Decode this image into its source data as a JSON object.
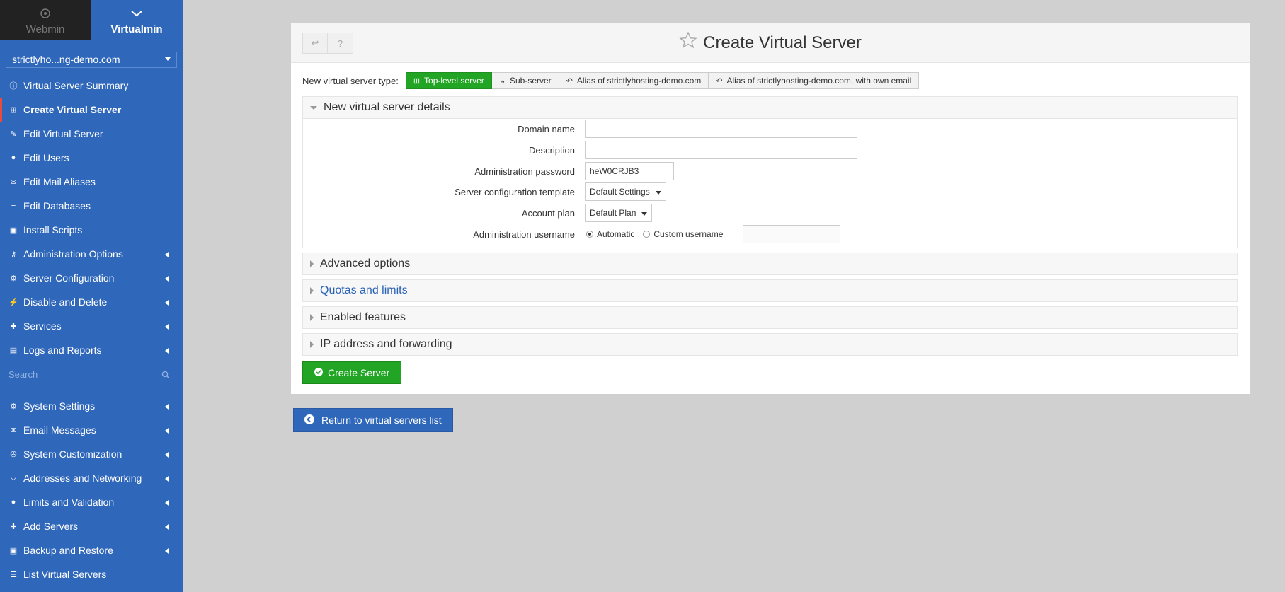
{
  "switcher": {
    "webmin_label": "Webmin",
    "virtualmin_label": "Virtualmin"
  },
  "domain_select": {
    "value": "strictlyho...ng-demo.com"
  },
  "sidebar": {
    "items": [
      {
        "label": "Virtual Server Summary",
        "icon": "info-circle-icon"
      },
      {
        "label": "Create Virtual Server",
        "icon": "plus-square-icon"
      },
      {
        "label": "Edit Virtual Server",
        "icon": "edit-icon"
      },
      {
        "label": "Edit Users",
        "icon": "users-icon"
      },
      {
        "label": "Edit Mail Aliases",
        "icon": "envelope-icon"
      },
      {
        "label": "Edit Databases",
        "icon": "database-icon"
      },
      {
        "label": "Install Scripts",
        "icon": "script-icon"
      },
      {
        "label": "Administration Options",
        "icon": "key-icon"
      },
      {
        "label": "Server Configuration",
        "icon": "cogs-icon"
      },
      {
        "label": "Disable and Delete",
        "icon": "plug-icon"
      },
      {
        "label": "Services",
        "icon": "puzzle-icon"
      },
      {
        "label": "Logs and Reports",
        "icon": "file-icon"
      }
    ],
    "search_placeholder": "Search",
    "items2": [
      {
        "label": "System Settings",
        "icon": "gear-icon"
      },
      {
        "label": "Email Messages",
        "icon": "envelope-icon"
      },
      {
        "label": "System Customization",
        "icon": "wrench-icon"
      },
      {
        "label": "Addresses and Networking",
        "icon": "shield-icon"
      },
      {
        "label": "Limits and Validation",
        "icon": "user-lock-icon"
      },
      {
        "label": "Add Servers",
        "icon": "plus-icon"
      },
      {
        "label": "Backup and Restore",
        "icon": "save-icon"
      },
      {
        "label": "List Virtual Servers",
        "icon": "list-icon"
      }
    ]
  },
  "page": {
    "title": "Create Virtual Server",
    "type_label": "New virtual server type:",
    "types": [
      "Top-level server",
      "Sub-server",
      "Alias of strictlyhosting-demo.com",
      "Alias of strictlyhosting-demo.com, with own email"
    ],
    "details_section": "New virtual server details",
    "fields": {
      "domain_name": "Domain name",
      "description": "Description",
      "admin_password": "Administration password",
      "admin_password_value": "heW0CRJB3",
      "template": "Server configuration template",
      "template_value": "Default Settings",
      "plan": "Account plan",
      "plan_value": "Default Plan",
      "username": "Administration username",
      "username_auto": "Automatic",
      "username_custom": "Custom username"
    },
    "sections": [
      "Advanced options",
      "Quotas and limits",
      "Enabled features",
      "IP address and forwarding"
    ],
    "create_button": "Create Server",
    "return_button": "Return to virtual servers list"
  }
}
